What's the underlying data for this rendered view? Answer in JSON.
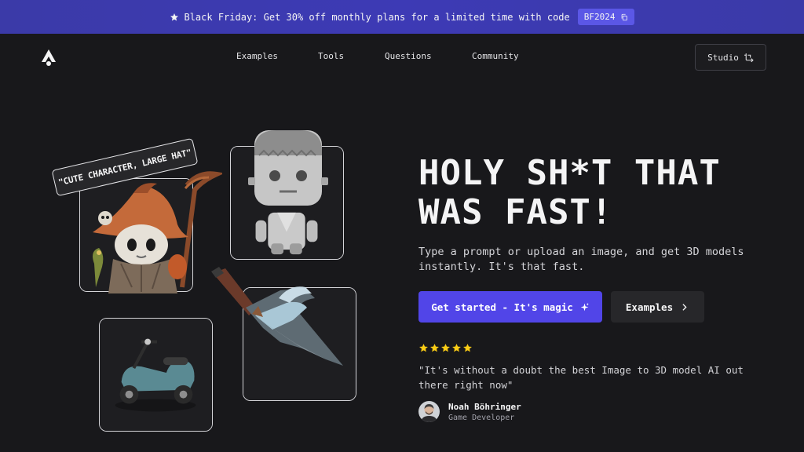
{
  "banner": {
    "text": "Black Friday: Get 30% off monthly plans for a limited time with code",
    "code": "BF2024",
    "icon": "star-icon"
  },
  "nav": {
    "logo_icon": "logo-icon",
    "links": [
      "Examples",
      "Tools",
      "Questions",
      "Community"
    ],
    "studio_label": "Studio",
    "studio_icon": "crop-arrow-icon"
  },
  "hero": {
    "title_line1": "HOLY SH*T THAT",
    "title_line2": "WAS FAST!",
    "subtitle": "Type a prompt or upload an image, and get 3D models instantly. It's that fast.",
    "primary_cta": "Get started - It's magic",
    "secondary_cta": "Examples",
    "rating_stars": 5,
    "quote": "\"It's without a doubt the best Image to 3D model AI out there right now\"",
    "author_name": "Noah Böhringer",
    "author_role": "Game Developer"
  },
  "showcase": {
    "prompt_tag": "\"CUTE CHARACTER, LARGE HAT\"",
    "items": [
      "hat-character",
      "frankenstein-figure",
      "scooter-model",
      "blade-weapon"
    ]
  },
  "colors": {
    "background": "#18181b",
    "banner": "#3b3aa8",
    "accent": "#5145e8",
    "star": "#facc15"
  }
}
